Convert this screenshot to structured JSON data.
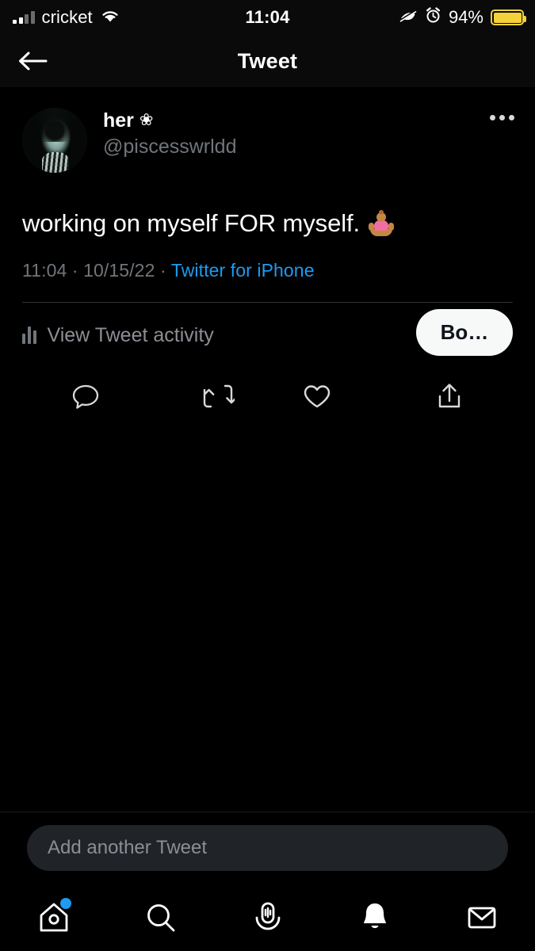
{
  "status_bar": {
    "carrier": "cricket",
    "time": "11:04",
    "battery_percent": "94%",
    "icons": [
      "signal-bars-icon",
      "wifi-icon",
      "do-not-disturb-icon",
      "alarm-clock-icon",
      "battery-icon"
    ],
    "battery_color": "#f3d13a"
  },
  "navbar": {
    "back_label": "←",
    "title": "Tweet"
  },
  "tweet": {
    "display_name": "her",
    "name_glyph": "❀",
    "handle": "@piscesswrldd",
    "text": "working on myself FOR myself.",
    "emoji_name": "woman-in-lotus-position-emoji",
    "more_label": "•••",
    "meta": {
      "time": "11:04",
      "separator": "·",
      "date": "10/15/22",
      "source": "Twitter for iPhone",
      "source_color": "#1d9bf0"
    },
    "activity": {
      "label": "View Tweet activity",
      "icon": "bar-chart-icon"
    },
    "boost_button": {
      "label": "Bo…"
    },
    "actions": [
      {
        "name": "reply-icon",
        "label": "Reply"
      },
      {
        "name": "retweet-icon",
        "label": "Retweet"
      },
      {
        "name": "like-icon",
        "label": "Like"
      },
      {
        "name": "share-icon",
        "label": "Share"
      }
    ]
  },
  "compose": {
    "placeholder": "Add another Tweet",
    "value": ""
  },
  "tabbar": {
    "items": [
      {
        "name": "tab-home",
        "icon": "home-icon",
        "badge": true
      },
      {
        "name": "tab-search",
        "icon": "search-icon",
        "badge": false
      },
      {
        "name": "tab-spaces",
        "icon": "microphone-icon",
        "badge": false
      },
      {
        "name": "tab-notifications",
        "icon": "bell-icon",
        "badge": false
      },
      {
        "name": "tab-messages",
        "icon": "envelope-icon",
        "badge": false
      }
    ],
    "badge_color": "#1d9bf0"
  }
}
